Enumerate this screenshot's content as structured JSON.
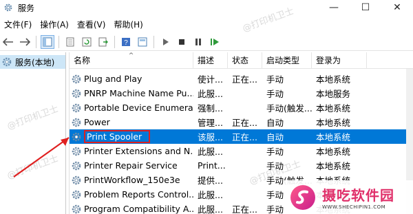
{
  "window": {
    "title": "服务",
    "minimize": "—",
    "maximize": "☐",
    "close": "✕"
  },
  "menu": [
    "文件(F)",
    "操作(A)",
    "查看(V)",
    "帮助(H)"
  ],
  "left_pane": {
    "tree_item": "服务(本地)"
  },
  "columns": {
    "name": "名称",
    "desc": "描述",
    "status": "状态",
    "start": "启动类型",
    "logon": "登录为"
  },
  "services": [
    {
      "name": "Plug and Play",
      "desc": "使计...",
      "status": "正在...",
      "start": "手动",
      "logon": "本地系统"
    },
    {
      "name": "PNRP Machine Name Pu...",
      "desc": "此服...",
      "status": "",
      "start": "手动",
      "logon": "本地服务"
    },
    {
      "name": "Portable Device Enumera...",
      "desc": "强制...",
      "status": "",
      "start": "手动(触发...",
      "logon": "本地系统"
    },
    {
      "name": "Power",
      "desc": "管理...",
      "status": "正在...",
      "start": "自动",
      "logon": "本地系统"
    },
    {
      "name": "Print Spooler",
      "desc": "该服...",
      "status": "正在...",
      "start": "自动",
      "logon": "本地系统",
      "selected": true
    },
    {
      "name": "Printer Extensions and N...",
      "desc": "此服...",
      "status": "",
      "start": "手动",
      "logon": "本地系统"
    },
    {
      "name": "Printer Repair Service",
      "desc": "Print...",
      "status": "",
      "start": "手动",
      "logon": "本地系统"
    },
    {
      "name": "PrintWorkflow_150e3e",
      "desc": "提供...",
      "status": "",
      "start": "手动(触发...",
      "logon": "本地系统"
    },
    {
      "name": "Problem Reports Control...",
      "desc": "此服...",
      "status": "",
      "start": "手动",
      "logon": "本地系统"
    },
    {
      "name": "Program Compatibility A...",
      "desc": "此服...",
      "status": "正在...",
      "start": "手动",
      "logon": "本地系统"
    }
  ],
  "watermark": "@打印机卫士",
  "brand": {
    "name": "摄吃软件园",
    "url": "WWW.SHECHIPIN1.COM"
  },
  "colors": {
    "selection": "#0078d7",
    "highlight_box": "#e02020",
    "brand": "#e0306a"
  }
}
